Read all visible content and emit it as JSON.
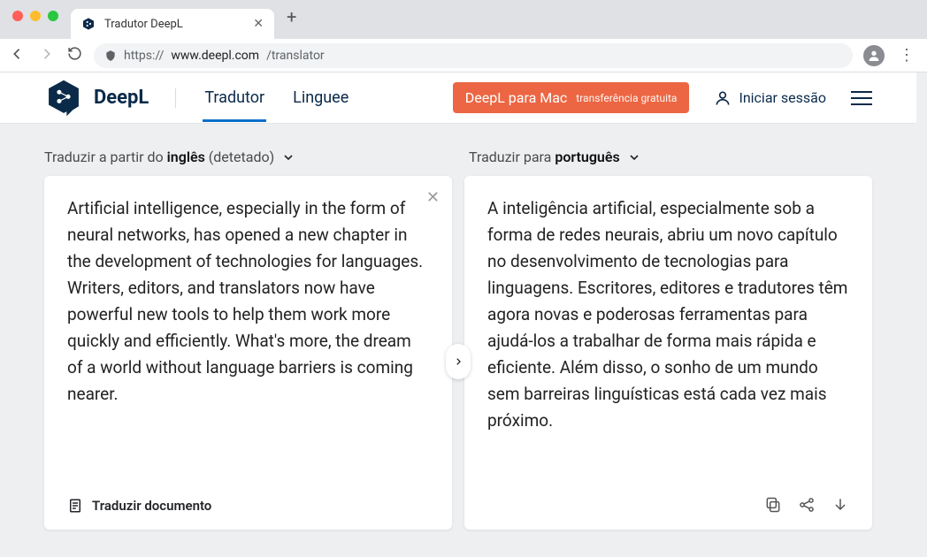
{
  "browser": {
    "tab_title": "Tradutor DeepL",
    "url_prefix": "https://",
    "url_domain": "www.deepl.com",
    "url_path": "/translator"
  },
  "header": {
    "brand": "DeepL",
    "nav": {
      "translator": "Tradutor",
      "linguee": "Linguee"
    },
    "mac_btn": {
      "main": "DeepL para Mac",
      "sub": "transferência gratuita"
    },
    "login": "Iniciar sessão"
  },
  "langs": {
    "from_prefix": "Traduzir a partir do ",
    "from_lang": "inglês",
    "from_suffix": " (detetado)",
    "to_prefix": "Traduzir para ",
    "to_lang": "português"
  },
  "source_text": "Artificial intelligence, especially in the form of neural networks, has opened a new chapter in the development of technologies for languages. Writers, editors, and translators now have powerful new tools to help them work more quickly and efficiently. What's more, the dream of a world without language barriers is coming nearer.",
  "target_text": "A inteligência artificial, especialmente sob a forma de redes neurais, abriu um novo capítulo no desenvolvimento de tecnologias para linguagens. Escritores, editores e tradutores têm agora novas e poderosas ferramentas para ajudá-los a trabalhar de forma mais rápida e eficiente. Além disso, o sonho de um mundo sem barreiras linguísticas está cada vez mais próximo.",
  "footer": {
    "translate_doc": "Traduzir documento"
  }
}
